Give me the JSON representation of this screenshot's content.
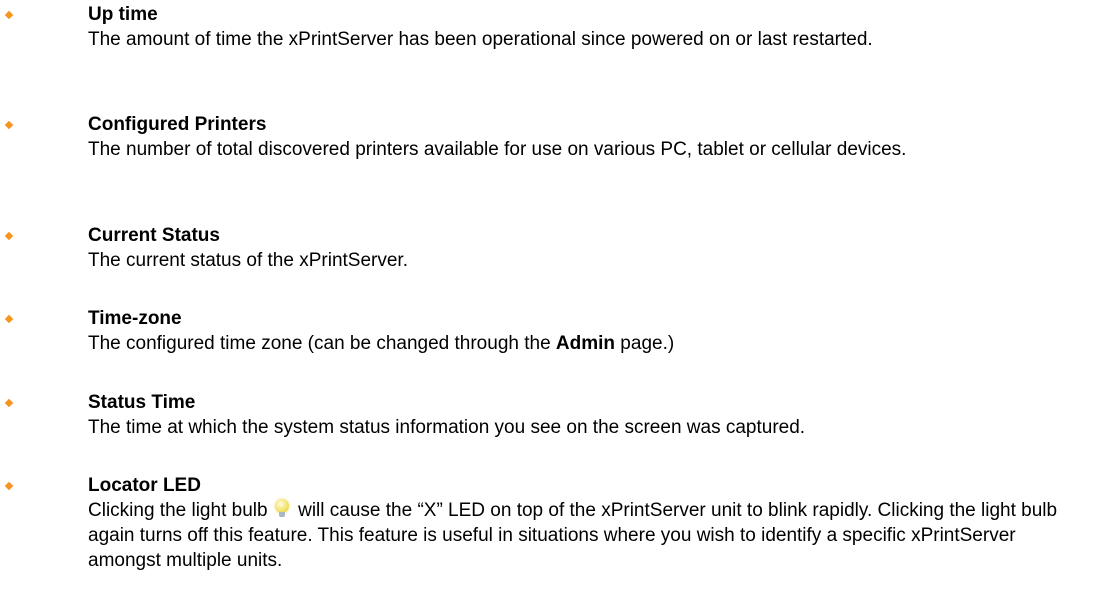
{
  "items": [
    {
      "term": "Up time",
      "desc": "The amount of time the xPrintServer has been operational since powered on or last restarted."
    },
    {
      "term": "Configured Printers",
      "desc": "The number of total discovered printers available for use on various PC, tablet or cellular devices."
    },
    {
      "term": "Current Status",
      "desc": "The current status of the xPrintServer."
    },
    {
      "term": "Time-zone",
      "desc_before": "The configured time zone (can be changed through the ",
      "desc_bold": "Admin",
      "desc_after": " page.)"
    },
    {
      "term": "Status Time",
      "desc": "The time at which the system status information you see on the screen was captured."
    },
    {
      "term": "Locator LED",
      "desc_before": "Clicking the light bulb",
      "desc_after": "will cause the “X” LED on top of the xPrintServer unit to blink rapidly.  Clicking the light bulb again turns off this feature.  This feature is useful in situations where you wish to identify a specific xPrintServer amongst multiple units."
    }
  ],
  "bullet_color": "#f7941d",
  "bulb_icon": "light-bulb-icon"
}
